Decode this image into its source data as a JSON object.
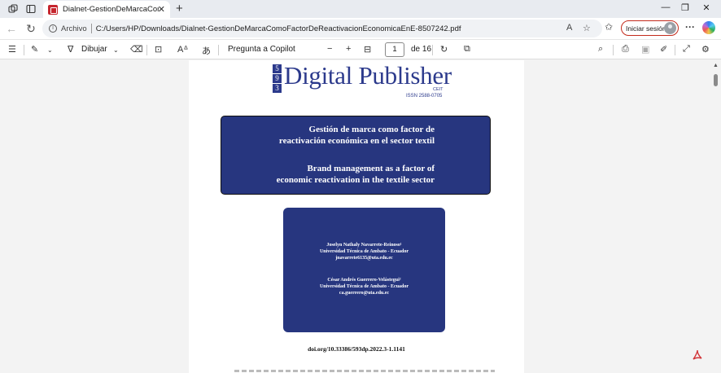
{
  "browser": {
    "tab_title": "Dialnet-GestionDeMarcaComoFac",
    "url_prefix": "Archivo",
    "url": "C:/Users/HP/Downloads/Dialnet-GestionDeMarcaComoFactorDeReactivacionEconomicaEnE-8507242.pdf",
    "signin_label": "Iniciar sesión"
  },
  "pdf_toolbar": {
    "draw_label": "Dibujar",
    "copilot_label": "Pregunta a Copilot",
    "page_current": "1",
    "page_total": "de 16"
  },
  "document": {
    "logo_digits": [
      "5",
      "9",
      "3"
    ],
    "logo_name": "Digital Publisher",
    "logo_ceit": "CEIT",
    "issn": "ISSN 2588-0705",
    "title_es_line1": "Gestión de marca como factor de",
    "title_es_line2": "reactivación económica en el sector textil",
    "title_en_line1": "Brand management as a factor of",
    "title_en_line2": "economic reactivation in the textile sector",
    "author1_name": "Joselyn Nathaly Navarrete-Reinoso¹",
    "author1_affiliation": "Universidad Técnica de Ambato - Ecuador",
    "author1_email": "jnavarrete6135@uta.edu.ec",
    "author2_name": "César Andrés Guerrero-Velástegui²",
    "author2_affiliation": "Universidad Técnica de Ambato - Ecuador",
    "author2_email": "ca.guerrero@uta.edu.ec",
    "doi": "doi.org/10.33386/593dp.2022.3-1.1141"
  },
  "colors": {
    "brand_blue": "#27367f",
    "signin_border": "#c42b1c"
  }
}
